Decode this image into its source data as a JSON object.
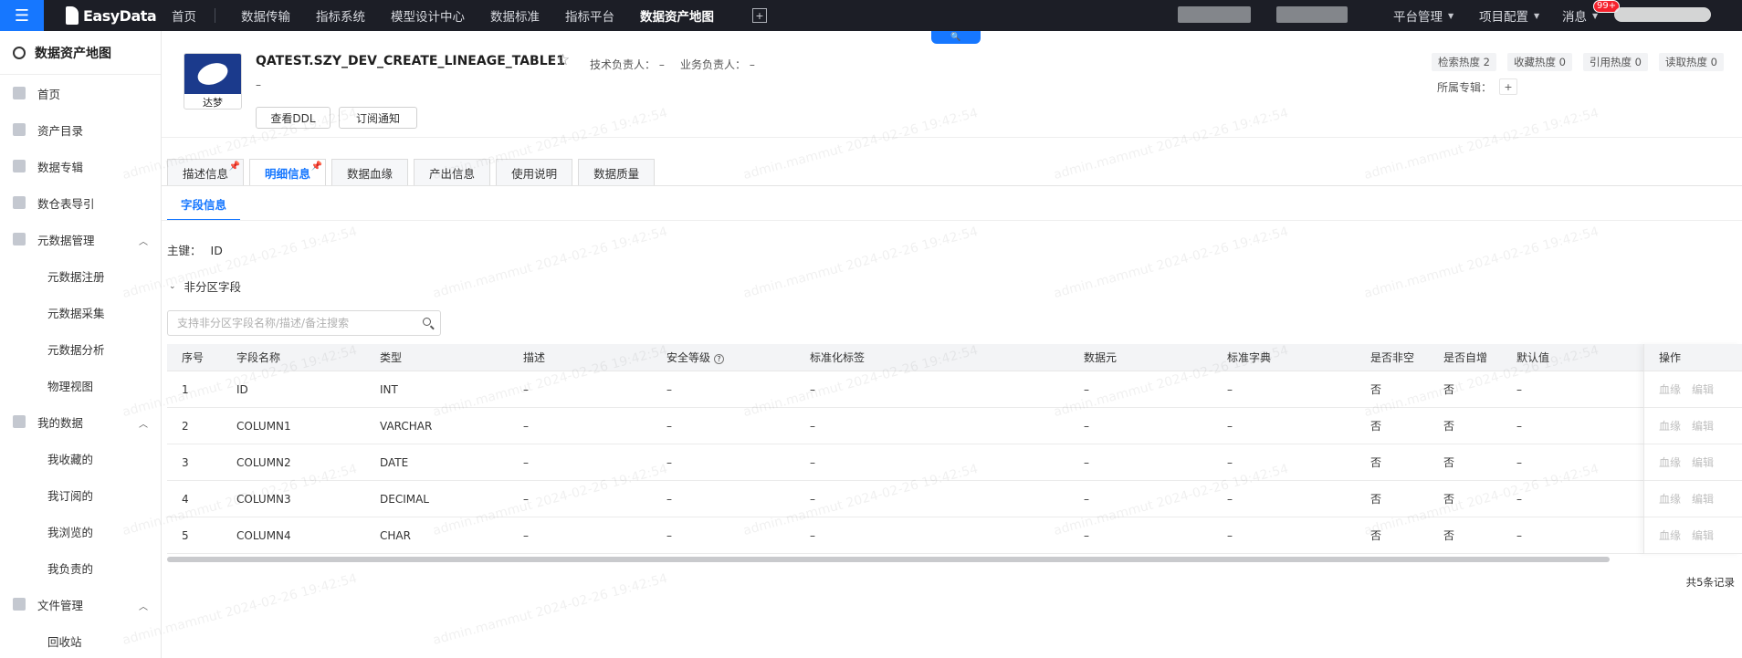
{
  "topbar": {
    "brand": "EasyData",
    "nav": [
      "首页",
      "数据传输",
      "指标系统",
      "模型设计中心",
      "数据标准",
      "指标平台",
      "数据资产地图"
    ],
    "active_nav": "数据资产地图",
    "right": {
      "platform": "平台管理",
      "project": "项目配置",
      "messages": "消息",
      "badge": "99+"
    }
  },
  "sidebar": {
    "title": "数据资产地图",
    "items": [
      {
        "label": "首页",
        "icon": "home-icon"
      },
      {
        "label": "资产目录",
        "icon": "catalog-icon"
      },
      {
        "label": "数据专辑",
        "icon": "album-icon"
      },
      {
        "label": "数仓表导引",
        "icon": "warehouse-icon"
      }
    ],
    "groups": [
      {
        "label": "元数据管理",
        "icon": "metadata-icon",
        "children": [
          "元数据注册",
          "元数据采集",
          "元数据分析",
          "物理视图"
        ]
      },
      {
        "label": "我的数据",
        "icon": "user-icon",
        "children": [
          "我收藏的",
          "我订阅的",
          "我浏览的",
          "我负责的"
        ]
      },
      {
        "label": "文件管理",
        "icon": "folder-icon",
        "children": [
          "回收站"
        ]
      }
    ]
  },
  "header": {
    "logo_label": "达梦",
    "table_name": "QATEST.SZY_DEV_CREATE_LINEAGE_TABLE1",
    "tech_owner": "技术负责人：  –",
    "biz_owner": "业务负责人：  –",
    "description": "–",
    "btn_ddl": "查看DDL",
    "btn_subscribe": "订阅通知",
    "heat": [
      "检索热度 2",
      "收藏热度 0",
      "引用热度 0",
      "读取热度 0"
    ],
    "topic_label": "所属专辑：",
    "topic_plus": "+"
  },
  "tabs": [
    "描述信息",
    "明细信息",
    "数据血缘",
    "产出信息",
    "使用说明",
    "数据质量"
  ],
  "active_tab": "明细信息",
  "subtab": "字段信息",
  "primary_key": {
    "label": "主键：",
    "value": "ID"
  },
  "section": "非分区字段",
  "search": {
    "placeholder": "支持非分区字段名称/描述/备注搜索"
  },
  "table": {
    "columns": [
      "序号",
      "字段名称",
      "类型",
      "描述",
      "安全等级",
      "标准化标签",
      "数据元",
      "标准字典",
      "是否非空",
      "是否自增",
      "默认值"
    ],
    "op_header": "操作",
    "rows": [
      [
        "1",
        "ID",
        "INT",
        "–",
        "–",
        "–",
        "–",
        "–",
        "否",
        "否",
        "–"
      ],
      [
        "2",
        "COLUMN1",
        "VARCHAR",
        "–",
        "–",
        "–",
        "–",
        "–",
        "否",
        "否",
        "–"
      ],
      [
        "3",
        "COLUMN2",
        "DATE",
        "–",
        "–",
        "–",
        "–",
        "–",
        "否",
        "否",
        "–"
      ],
      [
        "4",
        "COLUMN3",
        "DECIMAL",
        "–",
        "–",
        "–",
        "–",
        "–",
        "否",
        "否",
        "–"
      ],
      [
        "5",
        "COLUMN4",
        "CHAR",
        "–",
        "–",
        "–",
        "–",
        "–",
        "否",
        "否",
        "–"
      ]
    ],
    "op_links": [
      "血缘",
      "编辑"
    ],
    "total": "共5条记录"
  },
  "watermark": "admin.mammut 2024-02-26 19:42:54",
  "colors": {
    "accent": "#1677ff",
    "topbar": "#1c1e26"
  }
}
